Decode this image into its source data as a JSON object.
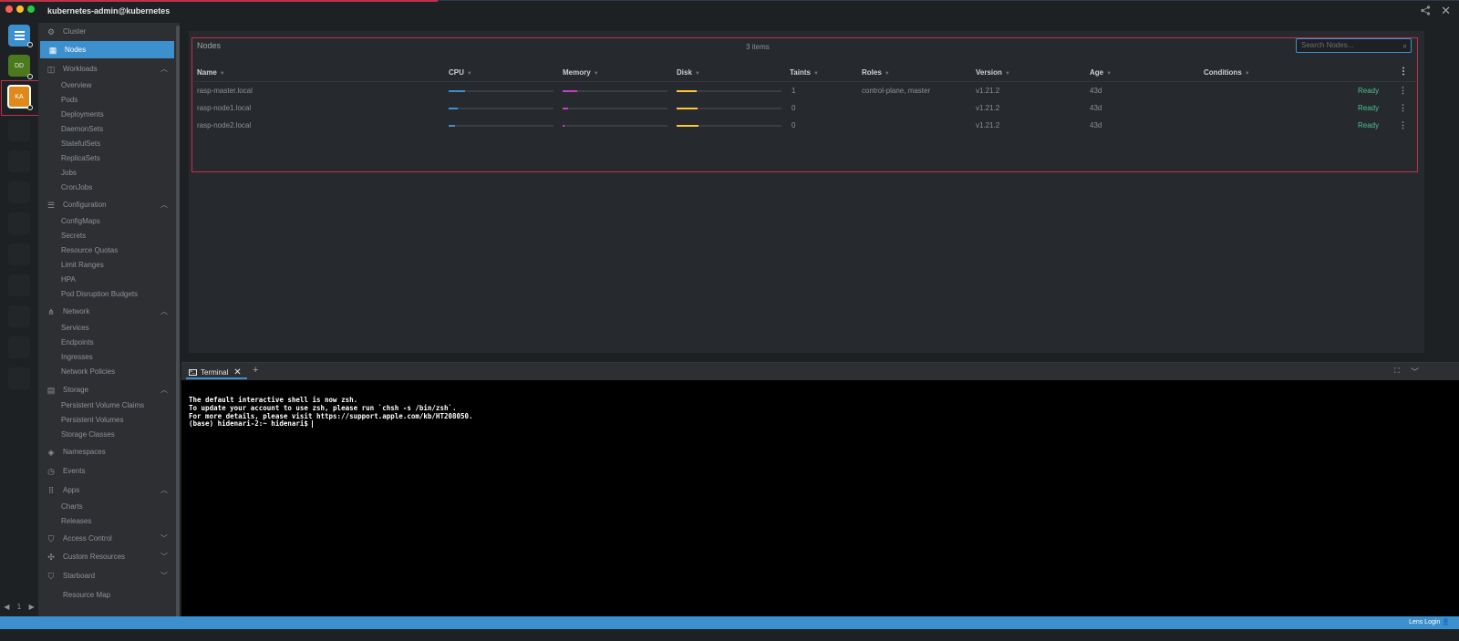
{
  "window": {
    "title": "kubernetes-admin@kubernetes"
  },
  "hotbar": {
    "items": [
      {
        "label": "",
        "icon": "cluster-icon",
        "color": "#3d90ce"
      },
      {
        "label": "DD",
        "color": "#4a7a1d"
      },
      {
        "label": "KA",
        "color": "#e0891a"
      }
    ],
    "page": "1"
  },
  "sidebar": {
    "cluster": "Cluster",
    "nodes": "Nodes",
    "workloads": {
      "label": "Workloads",
      "items": [
        "Overview",
        "Pods",
        "Deployments",
        "DaemonSets",
        "StatefulSets",
        "ReplicaSets",
        "Jobs",
        "CronJobs"
      ]
    },
    "configuration": {
      "label": "Configuration",
      "items": [
        "ConfigMaps",
        "Secrets",
        "Resource Quotas",
        "Limit Ranges",
        "HPA",
        "Pod Disruption Budgets"
      ]
    },
    "network": {
      "label": "Network",
      "items": [
        "Services",
        "Endpoints",
        "Ingresses",
        "Network Policies"
      ]
    },
    "storage": {
      "label": "Storage",
      "items": [
        "Persistent Volume Claims",
        "Persistent Volumes",
        "Storage Classes"
      ]
    },
    "namespaces": "Namespaces",
    "events": "Events",
    "apps": {
      "label": "Apps",
      "items": [
        "Charts",
        "Releases"
      ]
    },
    "access_control": "Access Control",
    "custom_resources": "Custom Resources",
    "starboard": "Starboard",
    "resource_map": "Resource Map"
  },
  "nodes": {
    "title": "Nodes",
    "count": "3 items",
    "search_placeholder": "Search Nodes...",
    "columns": [
      "Name",
      "CPU",
      "Memory",
      "Disk",
      "Taints",
      "Roles",
      "Version",
      "Age",
      "Conditions"
    ],
    "rows": [
      {
        "name": "rasp-master.local",
        "cpu": 0.16,
        "memory": 0.14,
        "disk": 0.19,
        "taints": "1",
        "roles": "control-plane, master",
        "version": "v1.21.2",
        "age": "43d",
        "conditions": "Ready"
      },
      {
        "name": "rasp-node1.local",
        "cpu": 0.09,
        "memory": 0.05,
        "disk": 0.2,
        "taints": "0",
        "roles": "",
        "version": "v1.21.2",
        "age": "43d",
        "conditions": "Ready"
      },
      {
        "name": "rasp-node2.local",
        "cpu": 0.06,
        "memory": 0.02,
        "disk": 0.21,
        "taints": "0",
        "roles": "",
        "version": "v1.21.2",
        "age": "43d",
        "conditions": "Ready"
      }
    ],
    "colors": {
      "cpu": "#3d90ce",
      "memory": "#c93dce",
      "disk": "#ffc63d",
      "ready": "#48c18d"
    }
  },
  "dock": {
    "tab_label": "Terminal",
    "terminal_lines": [
      "The default interactive shell is now zsh.",
      "To update your account to use zsh, please run `chsh -s /bin/zsh`.",
      "For more details, please visit https://support.apple.com/kb/HT208050.",
      "(base) hidenari-2:~ hidenari$ "
    ]
  },
  "status": {
    "login": "Lens Login"
  }
}
